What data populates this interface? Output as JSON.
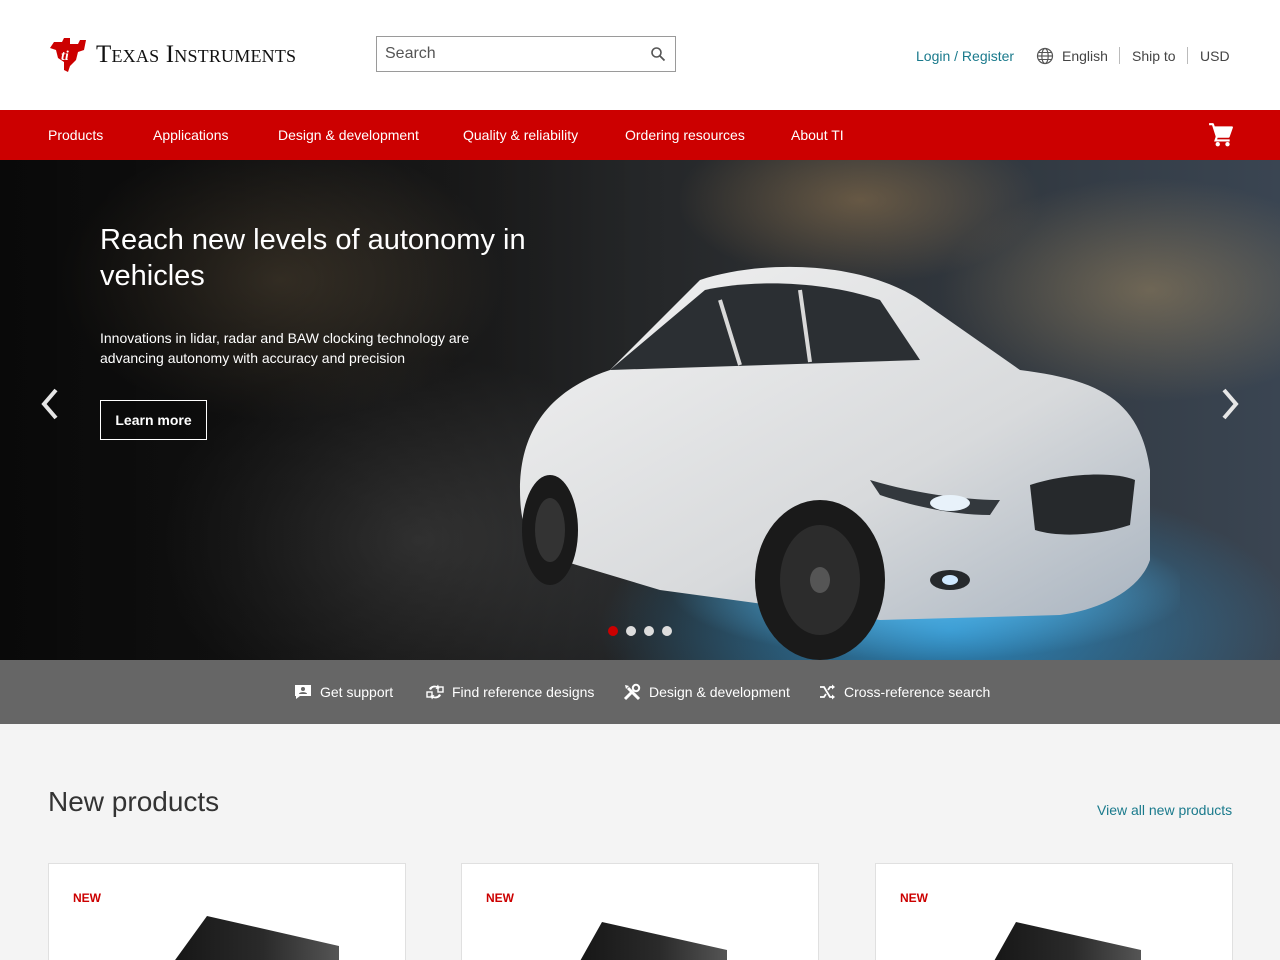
{
  "header": {
    "logo_text": "Texas Instruments",
    "search": {
      "placeholder": "Search"
    },
    "login_label": "Login / Register",
    "language_label": "English",
    "ship_to_label": "Ship to",
    "currency_label": "USD"
  },
  "nav": {
    "items": [
      {
        "label": "Products"
      },
      {
        "label": "Applications"
      },
      {
        "label": "Design & development"
      },
      {
        "label": "Quality & reliability"
      },
      {
        "label": "Ordering resources"
      },
      {
        "label": "About TI"
      }
    ]
  },
  "hero": {
    "title": "Reach new levels of autonomy in vehicles",
    "text": "Innovations in lidar, radar and BAW clocking technology are advancing autonomy with accuracy and precision",
    "button_label": "Learn more",
    "slide_count": 4,
    "active_slide": 1
  },
  "quick_links": [
    {
      "label": "Get support",
      "icon": "support-icon"
    },
    {
      "label": "Find reference designs",
      "icon": "reference-designs-icon"
    },
    {
      "label": "Design & development",
      "icon": "tools-icon"
    },
    {
      "label": "Cross-reference search",
      "icon": "shuffle-icon"
    }
  ],
  "new_products": {
    "title": "New products",
    "view_all_label": "View all new products",
    "cards": [
      {
        "badge": "NEW"
      },
      {
        "badge": "NEW"
      },
      {
        "badge": "NEW"
      }
    ]
  },
  "colors": {
    "brand_red": "#cc0000",
    "link_teal": "#1a7a8c",
    "quickbar_gray": "#666666"
  }
}
